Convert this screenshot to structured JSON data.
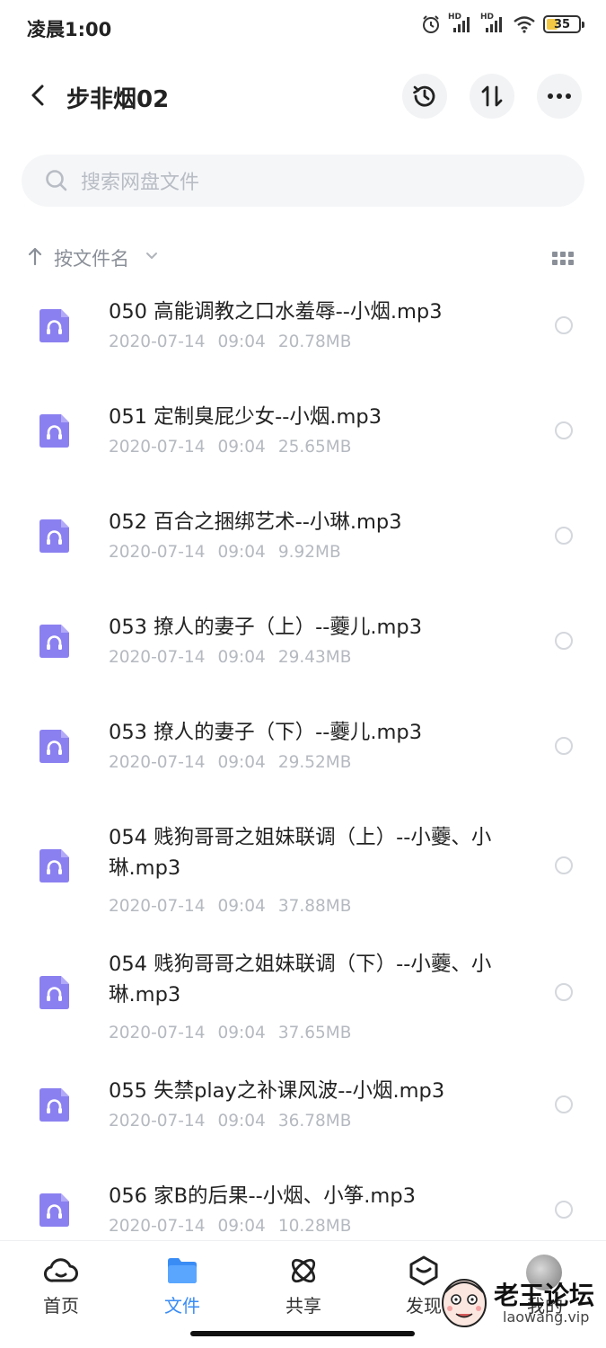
{
  "status_bar": {
    "time": "凌晨1:00",
    "battery": "35",
    "signal_labels": [
      "HD",
      "HD"
    ]
  },
  "header": {
    "title": "步非烟02",
    "icons": [
      "back-icon",
      "history-icon",
      "sort-icon",
      "more-icon"
    ]
  },
  "search": {
    "placeholder": "搜索网盘文件"
  },
  "sort": {
    "label": "按文件名"
  },
  "files": [
    {
      "name": "050 高能调教之口水羞辱--小烟.mp3",
      "date": "2020-07-14",
      "time": "09:04",
      "size": "20.78MB"
    },
    {
      "name": "051 定制臭屁少女--小烟.mp3",
      "date": "2020-07-14",
      "time": "09:04",
      "size": "25.65MB"
    },
    {
      "name": "052 百合之捆绑艺术--小琳.mp3",
      "date": "2020-07-14",
      "time": "09:04",
      "size": "9.92MB"
    },
    {
      "name": "053 撩人的妻子（上）--虁儿.mp3",
      "date": "2020-07-14",
      "time": "09:04",
      "size": "29.43MB"
    },
    {
      "name": "053 撩人的妻子（下）--虁儿.mp3",
      "date": "2020-07-14",
      "time": "09:04",
      "size": "29.52MB"
    },
    {
      "name": "054 贱狗哥哥之姐妹联调（上）--小虁、小琳.mp3",
      "date": "2020-07-14",
      "time": "09:04",
      "size": "37.88MB"
    },
    {
      "name": "054 贱狗哥哥之姐妹联调（下）--小虁、小琳.mp3",
      "date": "2020-07-14",
      "time": "09:04",
      "size": "37.65MB"
    },
    {
      "name": "055 失禁play之补课风波--小烟.mp3",
      "date": "2020-07-14",
      "time": "09:04",
      "size": "36.78MB"
    },
    {
      "name": "056 家B的后果--小烟、小筝.mp3",
      "date": "2020-07-14",
      "time": "09:04",
      "size": "10.28MB"
    }
  ],
  "nav": {
    "items": [
      {
        "label": "首页",
        "icon": "cloud-icon",
        "active": false
      },
      {
        "label": "文件",
        "icon": "folder-icon",
        "active": true
      },
      {
        "label": "共享",
        "icon": "atom-icon",
        "active": false
      },
      {
        "label": "发现",
        "icon": "discover-icon",
        "active": false
      },
      {
        "label": "我的",
        "icon": "avatar",
        "active": false
      }
    ]
  },
  "watermark": {
    "title": "老王论坛",
    "subtitle": "laowang.vip"
  },
  "colors": {
    "accent": "#3a8cf5",
    "file_icon": "#8b80f0",
    "meta_text": "#b5b9c0"
  }
}
